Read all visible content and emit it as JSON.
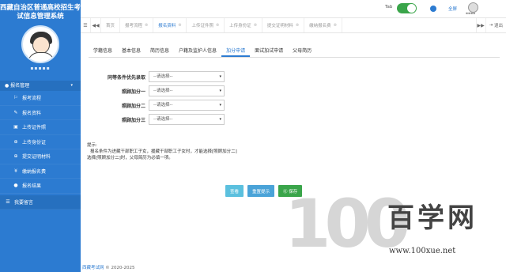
{
  "app": {
    "title": "西藏自治区普通高校招生考试信息管理系统",
    "user_name": "▪▪▪▪▪",
    "accent": "#2c7bd1"
  },
  "sidebar": {
    "group_label": "报名管理",
    "items": [
      {
        "icon": "flag-icon",
        "glyph": "⚐",
        "label": "报考流程"
      },
      {
        "icon": "edit-icon",
        "glyph": "✎",
        "label": "报名资料"
      },
      {
        "icon": "upload-icon",
        "glyph": "▣",
        "label": "上传证件照"
      },
      {
        "icon": "plus-circle-icon",
        "glyph": "⊕",
        "label": "上传身份证"
      },
      {
        "icon": "plus-circle-icon",
        "glyph": "⊕",
        "label": "提交证明材料"
      },
      {
        "icon": "yen-icon",
        "glyph": "¥",
        "label": "缴纳报名费"
      },
      {
        "icon": "user-icon",
        "glyph": "●",
        "label": "报名结果"
      }
    ],
    "bottom_item": {
      "icon": "list-icon",
      "glyph": "☰",
      "label": "我要留言"
    }
  },
  "header": {
    "toggle_label": "Tab",
    "fullscreen_label": "全屏",
    "user_label": "▪▪▪▪"
  },
  "tabs": [
    {
      "label": "首页"
    },
    {
      "label": "报考流程"
    },
    {
      "label": "报名资料"
    },
    {
      "label": "上传证件照"
    },
    {
      "label": "上传身份证"
    },
    {
      "label": "提交证明材料"
    },
    {
      "label": "缴纳报名费"
    }
  ],
  "logout_label": "退出",
  "subtabs": [
    "学籍信息",
    "基本信息",
    "简历信息",
    "户籍及监护人信息",
    "加分申请",
    "面试加试申请",
    "父母简历"
  ],
  "active_subtab": 4,
  "form": {
    "fields": [
      {
        "label": "同等条件优先录取",
        "value": "--请选择--"
      },
      {
        "label": "照顾加分一",
        "value": "--请选择--"
      },
      {
        "label": "照顾加分二",
        "value": "--请选择--"
      },
      {
        "label": "照顾加分三",
        "value": "--请选择--"
      }
    ]
  },
  "tips": {
    "title": "提示:",
    "lines": [
      "报名条件为进藏干部职工子女，援藏干部职工子女时，才能选择[照顾加分二]",
      "选择[照顾加分二]时，父母简历为必填一项。"
    ]
  },
  "buttons": {
    "view": "查看",
    "reset": "重置提示",
    "save": "保存"
  },
  "footer": {
    "link": "西藏考试网",
    "text": " © 2020-2025"
  },
  "watermark": {
    "number": "100",
    "text": "百学网",
    "url": "www.100xue.net"
  }
}
